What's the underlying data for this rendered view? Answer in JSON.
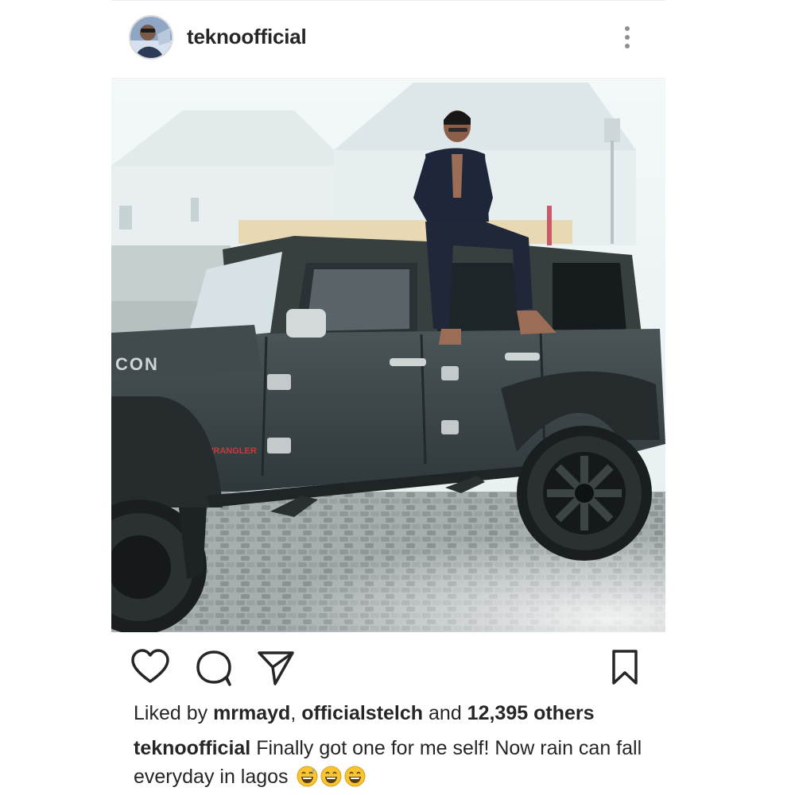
{
  "post": {
    "username": "teknoofficial",
    "more_icon": "more-vertical-icon",
    "photo_alt": "Man sitting on the roof of a dark grey Jeep Wrangler Unlimited",
    "actions": {
      "like_icon": "heart-icon",
      "comment_icon": "comment-icon",
      "share_icon": "send-icon",
      "save_icon": "bookmark-icon"
    },
    "likes": {
      "prefix": "Liked by ",
      "user1": "mrmayd",
      "separator": ", ",
      "user2": "officialstelch",
      "middle": " and ",
      "count": "12,395 others"
    },
    "caption": {
      "username": "teknoofficial",
      "text": " Finally got one for me self! Now rain can fall everyday in lagos",
      "emojis": [
        "grinning-sweat-emoji",
        "grinning-emoji",
        "grinning-emoji"
      ]
    }
  },
  "colors": {
    "text": "#262626",
    "divider": "#efefef",
    "vehicle": "#3b4447"
  }
}
